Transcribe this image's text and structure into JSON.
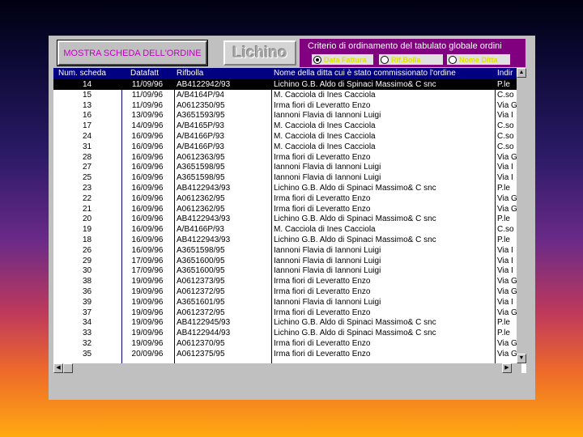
{
  "toolbar": {
    "show_order_label": "MOSTRA SCHEDA DELL'ORDINE",
    "logo_text": "Lichino"
  },
  "sort": {
    "title": "Criterio di ordinamento del tabulato globale ordini",
    "options": [
      {
        "label": "Data Fattura",
        "selected": true
      },
      {
        "label": "Rif.Bolla",
        "selected": false
      },
      {
        "label": "Nome Ditta",
        "selected": false
      }
    ]
  },
  "table": {
    "columns": [
      "Num. scheda",
      "Datafatt",
      "Rifbolla",
      "Nome della ditta cui è stato commissionato l'ordine",
      "Indir"
    ],
    "rows": [
      [
        "14",
        "11/09/96",
        "AB4122942/93",
        "Lichino G.B. Aldo di Spinaci Massimo& C snc",
        "P.le"
      ],
      [
        "15",
        "11/09/96",
        "A/B4164P/94",
        "M. Cacciola di Ines Cacciola",
        "C.so"
      ],
      [
        "13",
        "11/09/96",
        "A0612350/95",
        "Irma fiori di Leveratto Enzo",
        "Via G"
      ],
      [
        "16",
        "13/09/96",
        "A3651593/95",
        "Iannoni Flavia di Iannoni Luigi",
        "Via I"
      ],
      [
        "17",
        "14/09/96",
        "A/B4165P/93",
        "M. Cacciola di Ines Cacciola",
        "C.so"
      ],
      [
        "24",
        "16/09/96",
        "A/B4166P/93",
        "M. Cacciola di Ines Cacciola",
        "C.so"
      ],
      [
        "31",
        "16/09/96",
        "A/B4166P/93",
        "M. Cacciola di Ines Cacciola",
        "C.so"
      ],
      [
        "28",
        "16/09/96",
        "A0612363/95",
        "Irma fiori di Leveratto Enzo",
        "Via G"
      ],
      [
        "27",
        "16/09/96",
        "A3651598/95",
        "Iannoni Flavia di Iannoni Luigi",
        "Via I"
      ],
      [
        "25",
        "16/09/96",
        "A3651598/95",
        "Iannoni Flavia di Iannoni Luigi",
        "Via I"
      ],
      [
        "23",
        "16/09/96",
        "AB4122943/93",
        "Lichino G.B. Aldo di Spinaci Massimo& C snc",
        "P.le"
      ],
      [
        "22",
        "16/09/96",
        "A0612362/95",
        "Irma fiori di Leveratto Enzo",
        "Via G"
      ],
      [
        "21",
        "16/09/96",
        "A0612362/95",
        "Irma fiori di Leveratto Enzo",
        "Via G"
      ],
      [
        "20",
        "16/09/96",
        "AB4122943/93",
        "Lichino G.B. Aldo di Spinaci Massimo& C snc",
        "P.le"
      ],
      [
        "19",
        "16/09/96",
        "A/B4166P/93",
        "M. Cacciola di Ines Cacciola",
        "C.so"
      ],
      [
        "18",
        "16/09/96",
        "AB4122943/93",
        "Lichino G.B. Aldo di Spinaci Massimo& C snc",
        "P.le"
      ],
      [
        "26",
        "16/09/96",
        "A3651598/95",
        "Iannoni Flavia di Iannoni Luigi",
        "Via I"
      ],
      [
        "29",
        "17/09/96",
        "A3651600/95",
        "Iannoni Flavia di Iannoni Luigi",
        "Via I"
      ],
      [
        "30",
        "17/09/96",
        "A3651600/95",
        "Iannoni Flavia di Iannoni Luigi",
        "Via I"
      ],
      [
        "38",
        "19/09/96",
        "A0612373/95",
        "Irma fiori di Leveratto Enzo",
        "Via G"
      ],
      [
        "36",
        "19/09/96",
        "A0612372/95",
        "Irma fiori di Leveratto Enzo",
        "Via G"
      ],
      [
        "39",
        "19/09/96",
        "A3651601/95",
        "Iannoni Flavia di Iannoni Luigi",
        "Via I"
      ],
      [
        "37",
        "19/09/96",
        "A0612372/95",
        "Irma fiori di Leveratto Enzo",
        "Via G"
      ],
      [
        "34",
        "19/09/96",
        "AB4122945/93",
        "Lichino G.B. Aldo di Spinaci Massimo& C snc",
        "P.le"
      ],
      [
        "33",
        "19/09/96",
        "AB4122944/93",
        "Lichino G.B. Aldo di Spinaci Massimo& C snc",
        "P.le"
      ],
      [
        "32",
        "19/09/96",
        "A0612370/95",
        "Irma fiori di Leveratto Enzo",
        "Via G"
      ],
      [
        "35",
        "20/09/96",
        "A0612375/95",
        "Irma fiori di Leveratto Enzo",
        "Via G"
      ]
    ],
    "selected_row": 0
  },
  "colors": {
    "header_bg": "#000080",
    "sort_panel_bg": "#800080",
    "button_text": "#c000c0"
  }
}
